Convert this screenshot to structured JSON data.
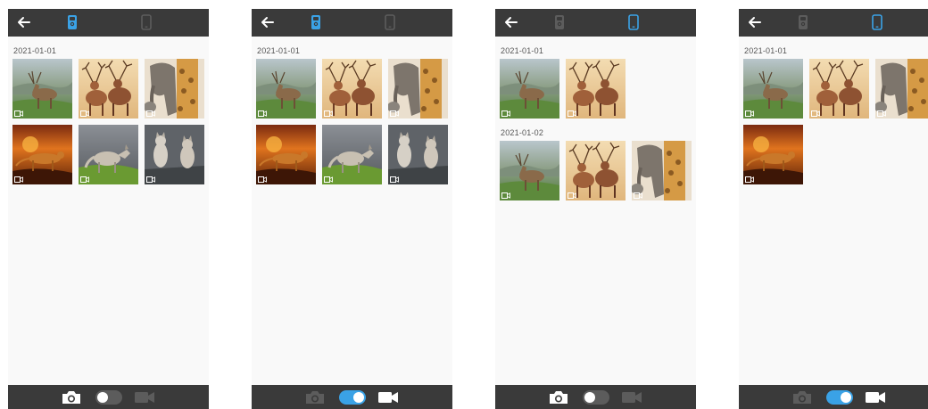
{
  "colors": {
    "accent": "#3aa2e6",
    "bar": "#3a3a3a",
    "inactive_icon": "#5c5c5c",
    "active_icon": "#ffffff",
    "toggle_off": "#5c5c5c",
    "toggle_on": "#3aa2e6"
  },
  "icons": {
    "back": "back-arrow-icon",
    "device_a": "camera-device-icon",
    "device_b": "phone-icon",
    "photo": "camera-icon",
    "video": "video-camera-icon",
    "video_tag": "video-badge-icon"
  },
  "screens": [
    {
      "active_device": "device_a",
      "mode": "photo",
      "groups": [
        {
          "date": "2021-01-01",
          "items": [
            "deer",
            "stags",
            "elephant-giraffe",
            "cheetah",
            "wolf",
            "wolves"
          ]
        }
      ]
    },
    {
      "active_device": "device_a",
      "mode": "video",
      "groups": [
        {
          "date": "2021-01-01",
          "items": [
            "deer",
            "stags",
            "elephant-giraffe",
            "cheetah",
            "wolf",
            "wolves"
          ]
        }
      ]
    },
    {
      "active_device": "device_b",
      "mode": "photo",
      "groups": [
        {
          "date": "2021-01-01",
          "items": [
            "deer",
            "stags"
          ]
        },
        {
          "date": "2021-01-02",
          "items": [
            "deer",
            "stags",
            "elephant-giraffe"
          ]
        }
      ]
    },
    {
      "active_device": "device_b",
      "mode": "video",
      "groups": [
        {
          "date": "2021-01-01",
          "items": [
            "deer",
            "stags",
            "elephant-giraffe",
            "cheetah"
          ]
        }
      ]
    }
  ]
}
